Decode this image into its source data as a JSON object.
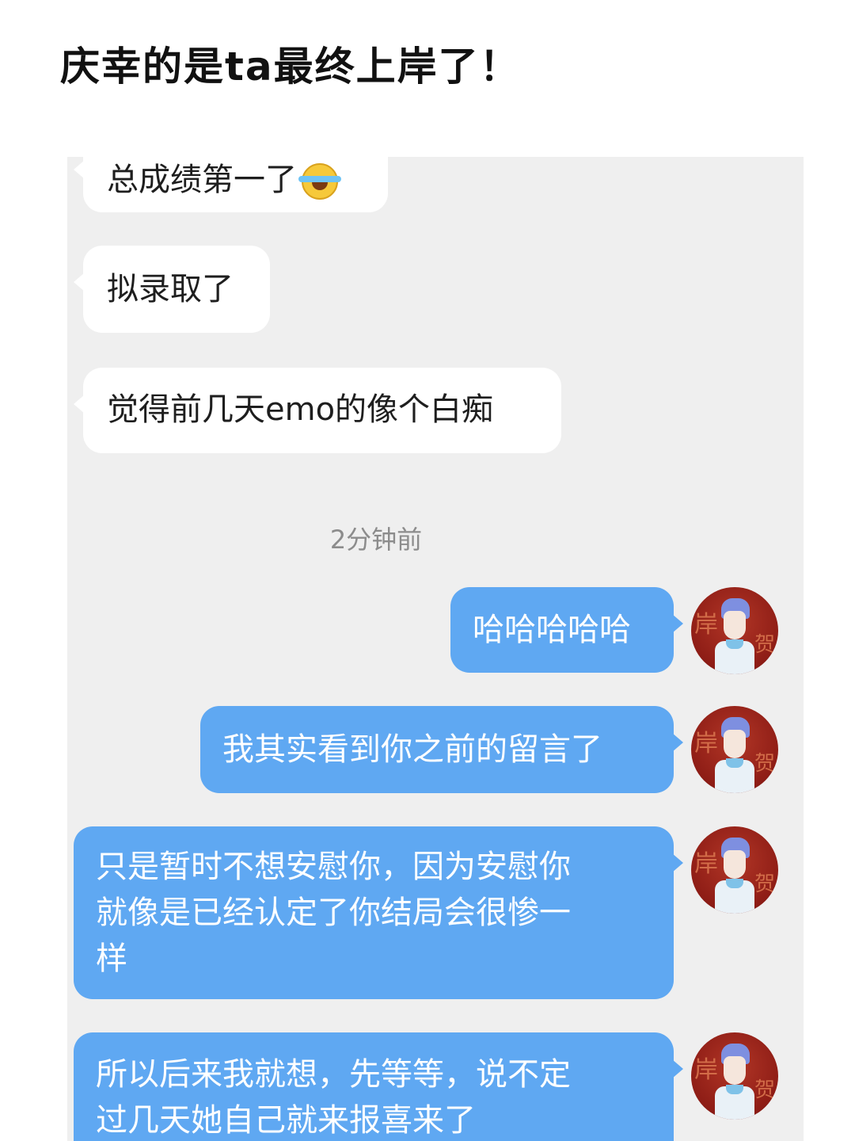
{
  "post": {
    "title": "庆幸的是ta最终上岸了！"
  },
  "chat": {
    "incoming": [
      {
        "text": "总成绩第一了",
        "emoji": "laughing-tears-emoji"
      },
      {
        "text": "拟录取了"
      },
      {
        "text": "觉得前几天emo的像个白痴"
      }
    ],
    "timestamp": "2分钟前",
    "outgoing": [
      {
        "lines": [
          "哈哈哈哈哈"
        ]
      },
      {
        "lines": [
          "我其实看到你之前的留言了"
        ]
      },
      {
        "lines": [
          "只是暂时不想安慰你，因为安慰你",
          "就像是已经认定了你结局会很惨一",
          "样"
        ]
      },
      {
        "lines": [
          "所以后来我就想，先等等，说不定",
          "过几天她自己就来报喜来了"
        ]
      }
    ],
    "avatar": {
      "left_char": "岸",
      "right_char": "贺"
    }
  },
  "colors": {
    "chat_background": "#efefef",
    "incoming_bubble": "#ffffff",
    "outgoing_bubble": "#5fa8f2",
    "timestamp_text": "#8c8c8c"
  }
}
